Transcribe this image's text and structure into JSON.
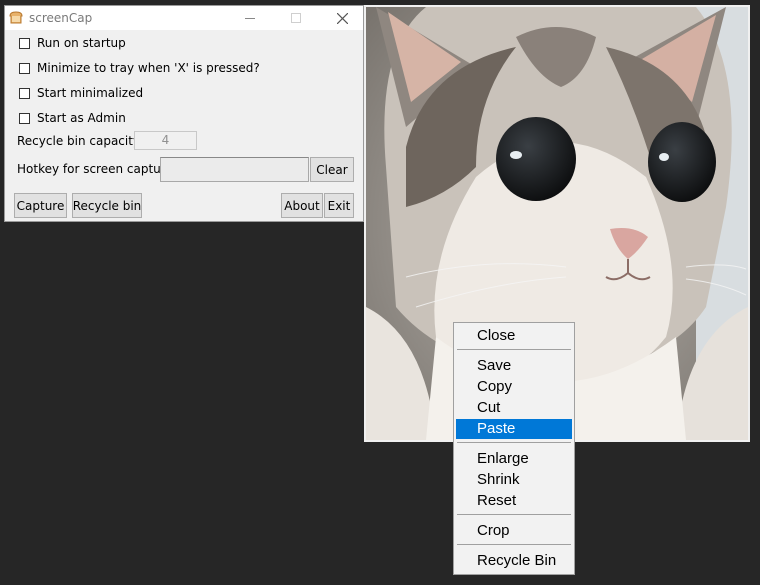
{
  "window": {
    "title": "screenCap",
    "checkboxes": [
      {
        "label": "Run on startup",
        "checked": false
      },
      {
        "label": "Minimize to tray when 'X' is pressed?",
        "checked": false
      },
      {
        "label": "Start minimalized",
        "checked": false
      },
      {
        "label": "Start as Admin",
        "checked": false
      }
    ],
    "recycle_bin_capacity": {
      "label": "Recycle bin capacity :",
      "value": "4"
    },
    "hotkey": {
      "label": "Hotkey for screen capture:",
      "value": "",
      "clear_label": "Clear"
    },
    "buttons": {
      "capture": "Capture",
      "recycle_bin": "Recycle bin",
      "about": "About",
      "exit": "Exit"
    }
  },
  "context_menu": {
    "items": [
      "Close",
      "Save",
      "Copy",
      "Cut",
      "Paste",
      "Enlarge",
      "Shrink",
      "Reset",
      "Crop",
      "Recycle Bin"
    ],
    "highlighted": "Paste",
    "highlight_color": "#0078d7"
  },
  "photo": {
    "subject": "cat-photo"
  },
  "colors": {
    "desktop": "#262626",
    "window_bg": "#f0f0f0"
  }
}
